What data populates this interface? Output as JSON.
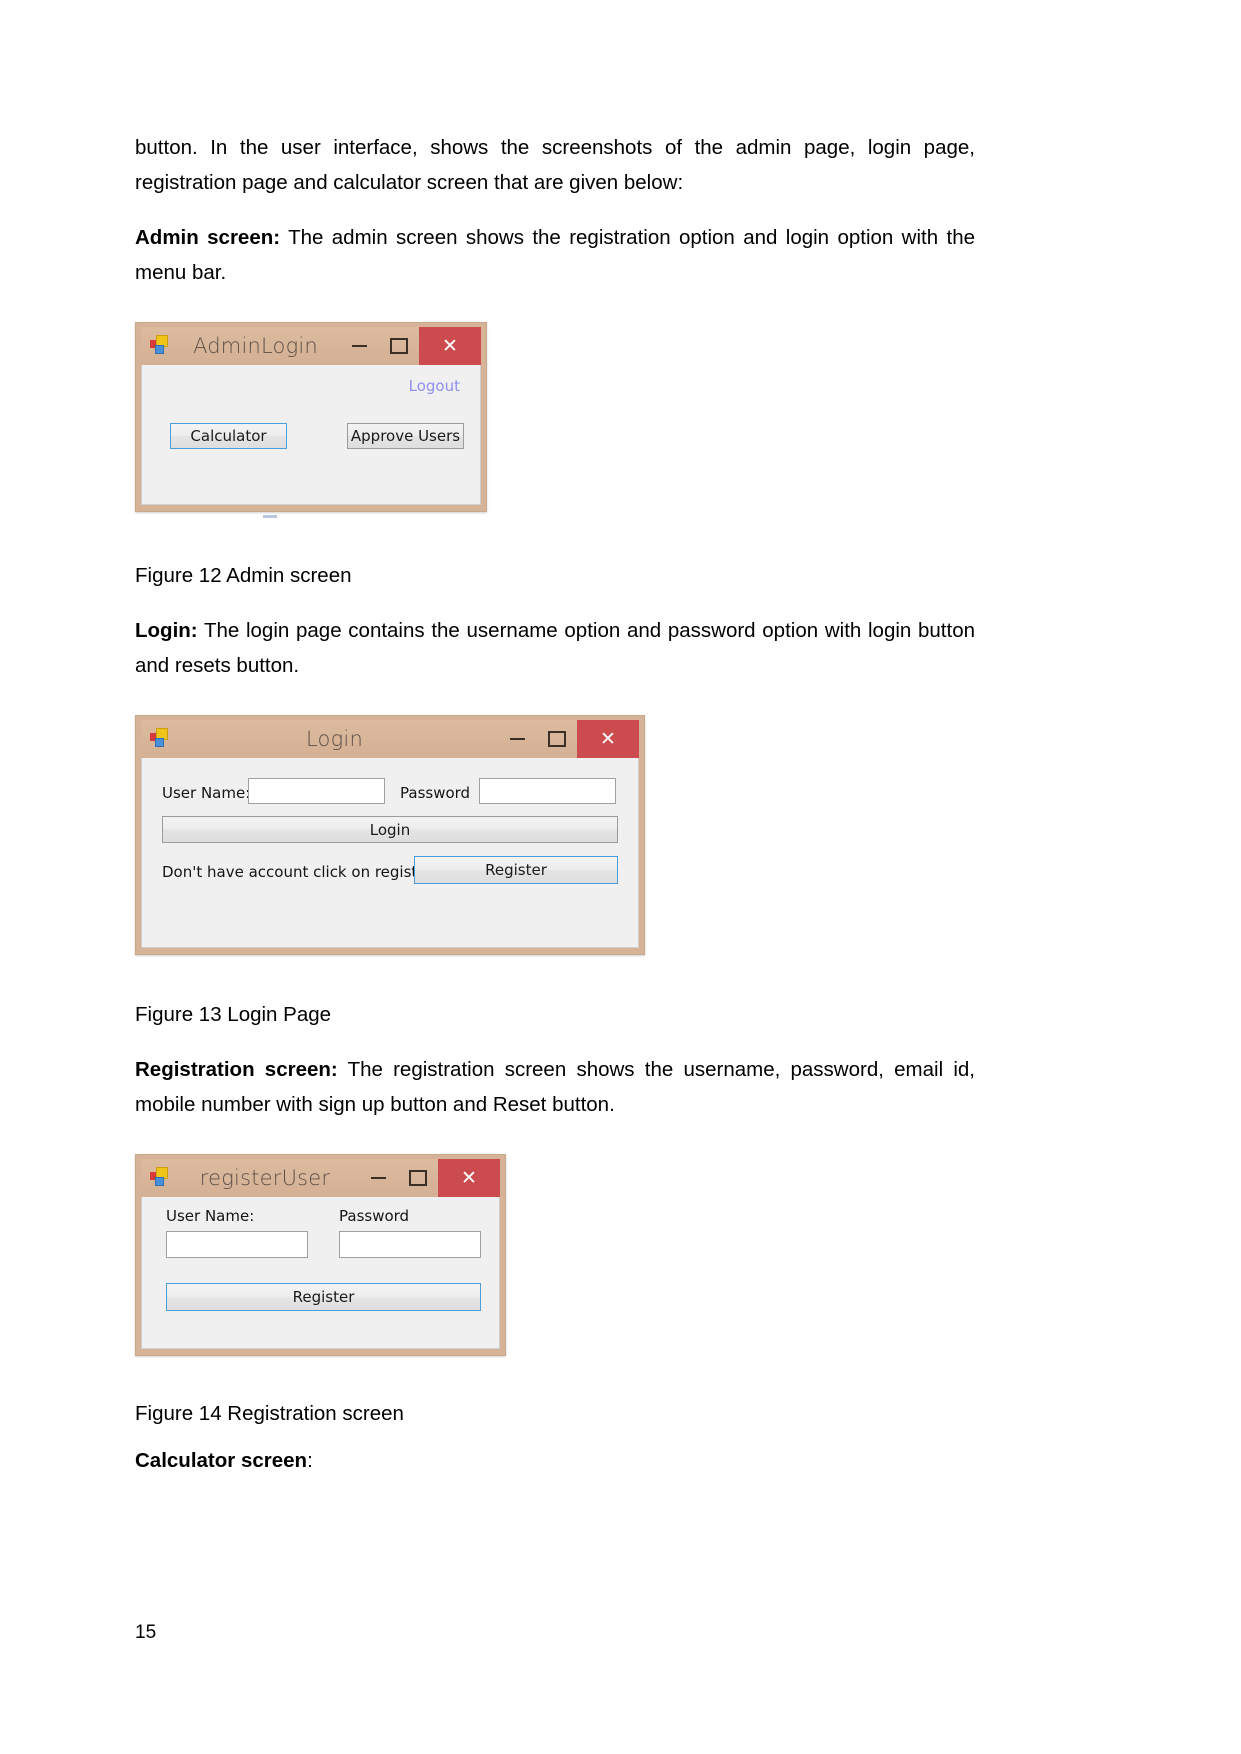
{
  "document": {
    "page_number": "15",
    "paragraphs": {
      "intro": "button. In the user interface, shows the screenshots of the admin page, login page, registration page and calculator screen that are given below:",
      "admin_lead": "Admin screen:",
      "admin_rest": " The admin screen shows the registration option and login option with the menu bar.",
      "login_lead": "Login:",
      "login_rest": " The login page contains the username option and password option with login button and resets button.",
      "registration_lead": "Registration screen:",
      "registration_rest": " The registration screen shows the username, password, email id, mobile number with sign up button and Reset button.",
      "calculator_lead": "Calculator screen",
      "calculator_rest": ":"
    },
    "captions": {
      "figure12": "Figure 12  Admin screen",
      "figure13": "Figure 13 Login Page",
      "figure14": "Figure 14 Registration screen"
    }
  },
  "admin_window": {
    "title": "AdminLogin",
    "icon": "visual-studio-form-icon",
    "minimize": "−",
    "maximize": "□",
    "close": "✕",
    "logout_link": "Logout",
    "calculator_button": "Calculator",
    "approve_users_button": "Approve Users"
  },
  "login_window": {
    "title": "Login",
    "icon": "visual-studio-form-icon",
    "minimize": "−",
    "maximize": "□",
    "close": "✕",
    "username_label": "User Name:",
    "username_value": "",
    "password_label": "Password",
    "password_value": "",
    "login_button": "Login",
    "register_hint": "Don't have account click on register",
    "register_button": "Register"
  },
  "register_window": {
    "title": "registerUser",
    "icon": "visual-studio-form-icon",
    "minimize": "−",
    "maximize": "□",
    "close": "✕",
    "username_label": "User Name:",
    "username_value": "",
    "password_label": "Password",
    "password_value": "",
    "register_button": "Register"
  },
  "colors": {
    "window_chrome": "#d6b396",
    "titlebar": "#dcbb9f",
    "close_button": "#cc4b4f",
    "body": "#f0f0f0",
    "focus_border": "#4c9ed9",
    "link": "#8f8ff0"
  }
}
